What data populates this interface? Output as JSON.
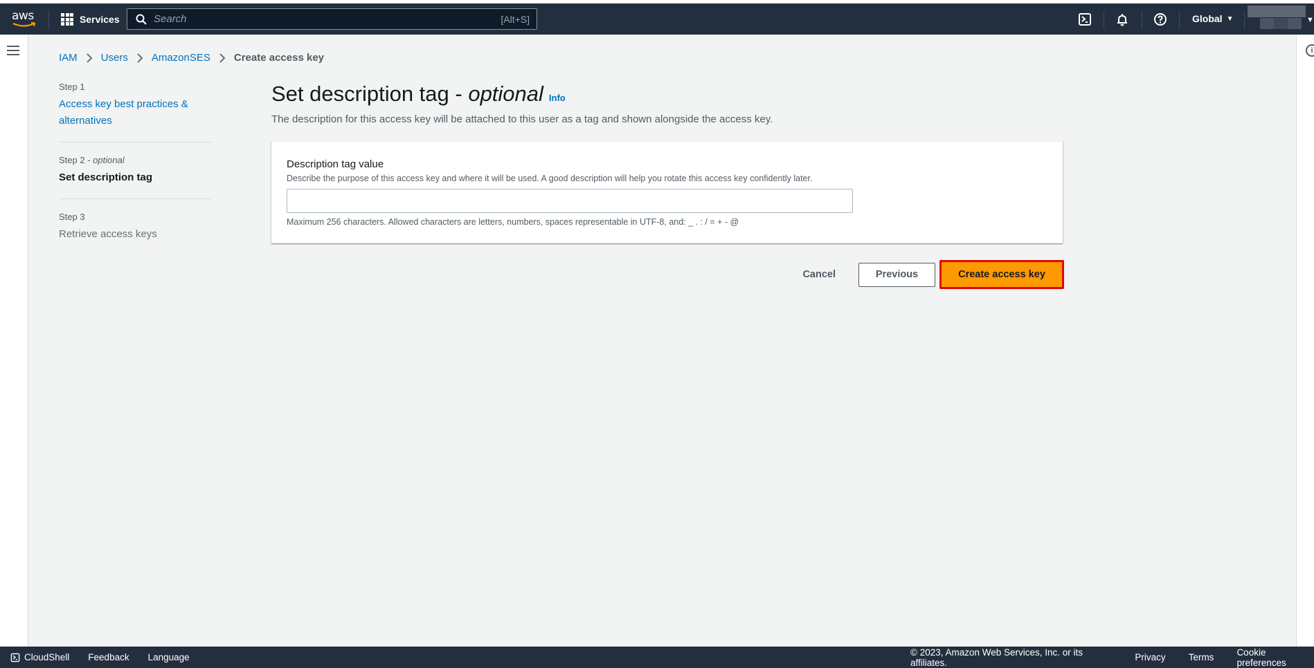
{
  "header": {
    "logo": "aws",
    "services_label": "Services",
    "search_placeholder": "Search",
    "search_shortcut": "[Alt+S]",
    "region_label": "Global",
    "icons": [
      "cloudshell-icon",
      "notifications-bell-icon",
      "help-icon"
    ]
  },
  "breadcrumb": [
    {
      "label": "IAM",
      "link": true
    },
    {
      "label": "Users",
      "link": true
    },
    {
      "label": "AmazonSES",
      "link": true
    },
    {
      "label": "Create access key",
      "link": false
    }
  ],
  "steps": [
    {
      "label": "Step 1",
      "optional": "",
      "title": "Access key best practices & alternatives",
      "state": "link"
    },
    {
      "label": "Step 2 - ",
      "optional": "optional",
      "title": "Set description tag",
      "state": "active"
    },
    {
      "label": "Step 3",
      "optional": "",
      "title": "Retrieve access keys",
      "state": "disabled"
    }
  ],
  "main": {
    "title": "Set description tag - ",
    "title_italic": "optional",
    "info_link": "Info",
    "description": "The description for this access key will be attached to this user as a tag and shown alongside the access key.",
    "field": {
      "label": "Description tag value",
      "description": "Describe the purpose of this access key and where it will be used. A good description will help you rotate this access key confidently later.",
      "value": "",
      "placeholder": "",
      "constraint": "Maximum 256 characters. Allowed characters are letters, numbers, spaces representable in UTF-8, and: _ . : / = + - @"
    },
    "actions": {
      "cancel": "Cancel",
      "previous": "Previous",
      "create": "Create access key"
    }
  },
  "footer": {
    "cloudshell": "CloudShell",
    "feedback": "Feedback",
    "language": "Language",
    "copyright": "© 2023, Amazon Web Services, Inc. or its affiliates.",
    "privacy": "Privacy",
    "terms": "Terms",
    "cookies": "Cookie preferences"
  },
  "colors": {
    "header_bg": "#232f3e",
    "link": "#0073bb",
    "primary_button": "#ff9900",
    "highlight_border": "#e3050c"
  }
}
